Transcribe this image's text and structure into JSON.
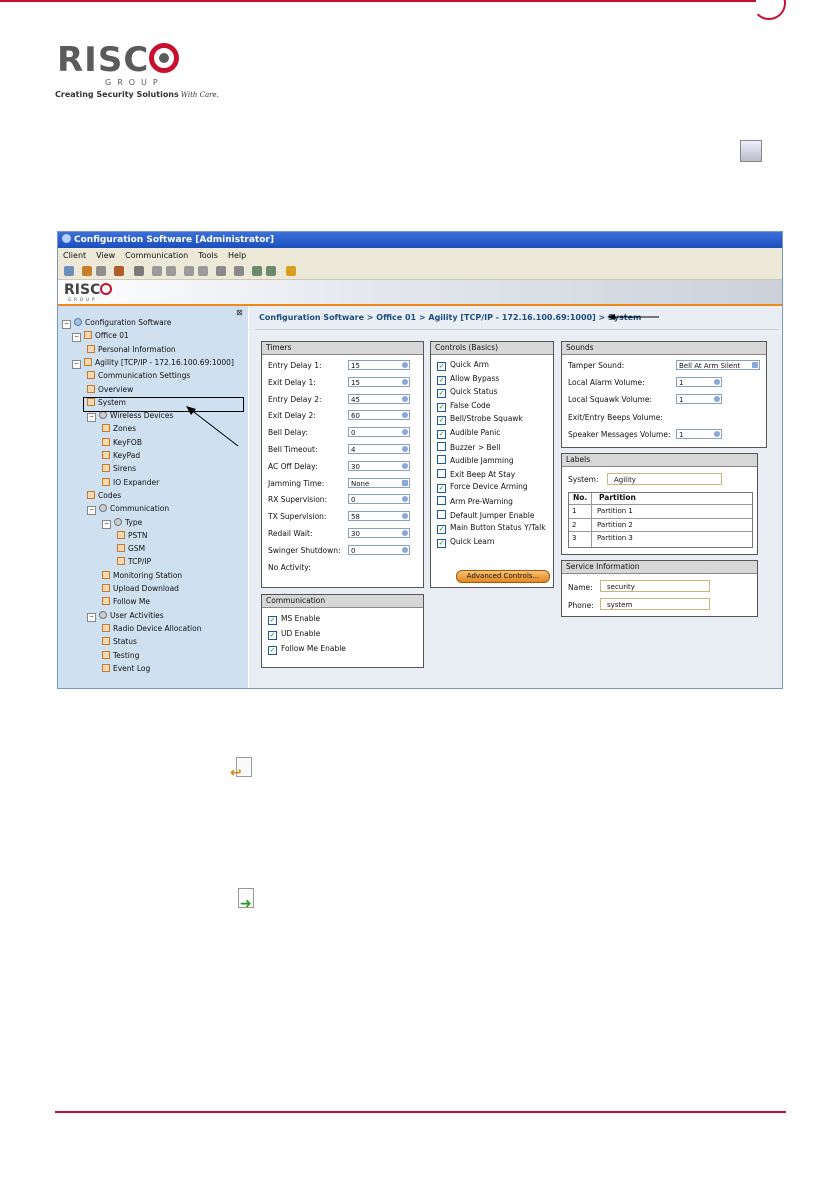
{
  "logo": {
    "word": "RISC",
    "group": "GROUP",
    "tagline": "Creating Security Solutions",
    "tagline_script": "With Care."
  },
  "window": {
    "title": "Configuration Software  [Administrator]",
    "menu": [
      "Client",
      "View",
      "Communication",
      "Tools",
      "Help"
    ],
    "brand": {
      "word": "RISC",
      "group": "GROUP"
    }
  },
  "tree": {
    "close": "⊠",
    "nodes": [
      {
        "label": "Configuration Software",
        "icon": "globe-icon",
        "exp": "−"
      },
      {
        "label": "Office 01",
        "icon": "office-icon",
        "exp": "−"
      },
      {
        "label": "Personal Information",
        "icon": "person-icon"
      },
      {
        "label": "Agility [TCP/IP - 172.16.100.69:1000]",
        "icon": "panel-icon",
        "exp": "−"
      },
      {
        "label": "Communication Settings",
        "icon": "comm-icon"
      },
      {
        "label": "Overview",
        "icon": "page-icon"
      },
      {
        "label": "System",
        "icon": "system-icon"
      },
      {
        "label": "Wireless Devices",
        "icon": "gear-icon",
        "exp": "−"
      },
      {
        "label": "Zones",
        "icon": "page-icon"
      },
      {
        "label": "KeyFOB",
        "icon": "page-icon"
      },
      {
        "label": "KeyPad",
        "icon": "page-icon"
      },
      {
        "label": "Sirens",
        "icon": "page-icon"
      },
      {
        "label": "IO Expander",
        "icon": "page-icon"
      },
      {
        "label": "Codes",
        "icon": "page-icon"
      },
      {
        "label": "Communication",
        "icon": "gear-icon",
        "exp": "−"
      },
      {
        "label": "Type",
        "icon": "gear-icon",
        "exp": "−"
      },
      {
        "label": "PSTN",
        "icon": "page-icon"
      },
      {
        "label": "GSM",
        "icon": "page-icon"
      },
      {
        "label": "TCP/IP",
        "icon": "page-icon"
      },
      {
        "label": "Monitoring Station",
        "icon": "page-icon"
      },
      {
        "label": "Upload Download",
        "icon": "page-icon"
      },
      {
        "label": "Follow Me",
        "icon": "page-icon"
      },
      {
        "label": "User Activities",
        "icon": "gear-icon",
        "exp": "−"
      },
      {
        "label": "Radio Device Allocation",
        "icon": "page-icon"
      },
      {
        "label": "Status",
        "icon": "page-icon"
      },
      {
        "label": "Testing",
        "icon": "page-icon"
      },
      {
        "label": "Event Log",
        "icon": "page-icon"
      }
    ]
  },
  "breadcrumb": "Configuration Software > Office 01 > Agility [TCP/IP - 172.16.100.69:1000] > System",
  "timers": {
    "title": "Timers",
    "rows": [
      {
        "label": "Entry Delay 1:",
        "value": "15"
      },
      {
        "label": "Exit Delay 1:",
        "value": "15"
      },
      {
        "label": "Entry Delay 2:",
        "value": "45"
      },
      {
        "label": "Exit Delay 2:",
        "value": "60"
      },
      {
        "label": "Bell Delay:",
        "value": "0"
      },
      {
        "label": "Bell Timeout:",
        "value": "4"
      },
      {
        "label": "AC Off Delay:",
        "value": "30"
      },
      {
        "label": "Jamming Time:",
        "value": "None"
      },
      {
        "label": "RX Supervision:",
        "value": "0"
      },
      {
        "label": "TX Supervision:",
        "value": "58"
      },
      {
        "label": "Redail Wait:",
        "value": "30"
      },
      {
        "label": "Swinger Shutdown:",
        "value": "0"
      },
      {
        "label": "No Activity:",
        "value": ""
      }
    ]
  },
  "communication": {
    "title": "Communication",
    "items": [
      {
        "label": "MS Enable",
        "checked": true
      },
      {
        "label": "UD Enable",
        "checked": true
      },
      {
        "label": "Follow Me Enable",
        "checked": true
      }
    ]
  },
  "controls": {
    "title": "Controls (Basics)",
    "items": [
      {
        "label": "Quick Arm",
        "checked": true
      },
      {
        "label": "Allow Bypass",
        "checked": true
      },
      {
        "label": "Quick Status",
        "checked": true
      },
      {
        "label": "False Code",
        "checked": true
      },
      {
        "label": "Bell/Strobe Squawk",
        "checked": true
      },
      {
        "label": "Audible Panic",
        "checked": true
      },
      {
        "label": "Buzzer > Bell",
        "checked": false
      },
      {
        "label": "Audible Jamming",
        "checked": false
      },
      {
        "label": "Exit Beep At Stay",
        "checked": false
      },
      {
        "label": "Force Device Arming",
        "checked": true
      },
      {
        "label": "Arm Pre-Warning",
        "checked": false
      },
      {
        "label": "Default Jumper Enable",
        "checked": false
      },
      {
        "label": "Main Button Status Y/Talk",
        "checked": true
      },
      {
        "label": "Quick Learn",
        "checked": true
      }
    ],
    "advanced_label": "Advanced Controls..."
  },
  "sounds": {
    "title": "Sounds",
    "rows": [
      {
        "label": "Tamper Sound:",
        "value": "Bell At Arm Silent"
      },
      {
        "label": "Local Alarm Volume:",
        "value": "1"
      },
      {
        "label": "Local Squawk Volume:",
        "value": "1"
      },
      {
        "label": "Exit/Entry Beeps Volume:",
        "value": ""
      },
      {
        "label": "Speaker Messages Volume:",
        "value": "1"
      }
    ]
  },
  "labels": {
    "title": "Labels",
    "system_label": "System:",
    "system_value": "Agility",
    "headers": [
      "No.",
      "Partition"
    ],
    "rows": [
      [
        "1",
        "Partition 1"
      ],
      [
        "2",
        "Partition 2"
      ],
      [
        "3",
        "Partition 3"
      ]
    ]
  },
  "service": {
    "title": "Service Information",
    "name_label": "Name:",
    "name_value": "security",
    "phone_label": "Phone:",
    "phone_value": "system"
  },
  "colors": {
    "accent_red": "#c8102e",
    "window_blue": "#1a4fbc",
    "orange": "#f08a1c"
  }
}
